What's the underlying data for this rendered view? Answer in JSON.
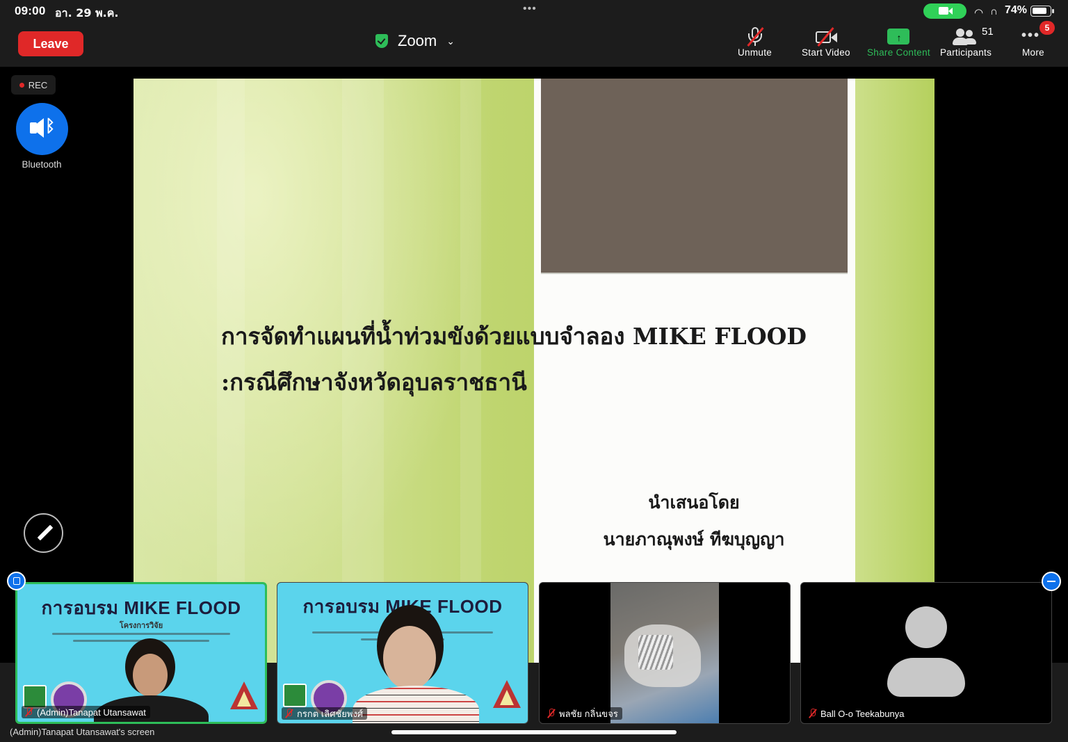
{
  "status_bar": {
    "time": "09:00",
    "date": "อา. 29 พ.ค.",
    "battery": "74%",
    "icons": [
      "camera-in-use-icon",
      "wifi-icon",
      "headphones-icon",
      "battery-icon"
    ]
  },
  "toolbar": {
    "leave_label": "Leave",
    "meeting_title": "Zoom",
    "buttons": [
      {
        "label": "Unmute",
        "icon": "microphone-muted-icon"
      },
      {
        "label": "Start Video",
        "icon": "video-off-icon"
      },
      {
        "label": "Share Content",
        "icon": "share-screen-icon"
      },
      {
        "label": "Participants",
        "icon": "participants-icon"
      },
      {
        "label": "More",
        "icon": "more-dots-icon"
      }
    ],
    "participants_count": "51",
    "more_badge": "5"
  },
  "floating": {
    "rec_label": "REC",
    "audio_label": "Bluetooth"
  },
  "slide": {
    "title_line1": "การจัดทำแผนที่น้ำท่วมขังด้วยแบบจำลอง MIKE FLOOD",
    "title_line2": ":กรณีศึกษาจังหวัดอุบลราชธานี",
    "presented_by": "นำเสนอโดย",
    "presenter": "นายภาณุพงษ์ ทีฆบุญญา"
  },
  "tiles": [
    {
      "name": "(Admin)Tanapat Utansawat",
      "muted": true,
      "active": true,
      "background_title": "การอบรม MIKE FLOOD",
      "background_sub": "โครงการวิจัย"
    },
    {
      "name": "กรกต เลิศชัยพงศ์",
      "muted": true,
      "active": false,
      "background_title": "การอบรม MIKE FLOOD"
    },
    {
      "name": "พลชัย กลิ่นขจร",
      "muted": true,
      "active": false
    },
    {
      "name": "Ball O-o Teekabunya",
      "muted": true,
      "active": false
    }
  ],
  "screen_label": "(Admin)Tanapat Utansawat's screen",
  "colors": {
    "leave_red": "#e02828",
    "share_green": "#2ebd59",
    "zoom_blue": "#0e71eb",
    "toolbar_bg": "#1c1c1c"
  }
}
